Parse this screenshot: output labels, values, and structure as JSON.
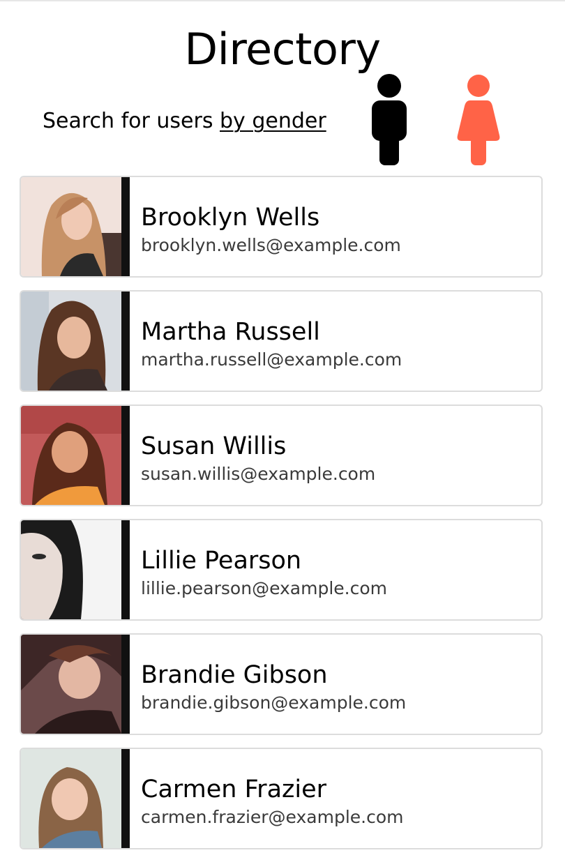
{
  "header": {
    "title": "Directory",
    "search_prefix": "Search for users ",
    "search_link": "by gender"
  },
  "gender_filter": {
    "male_icon": "male-person-icon",
    "female_icon": "female-person-icon",
    "male_color": "#000000",
    "female_color": "#ff6347"
  },
  "users": [
    {
      "name": "Brooklyn Wells",
      "email": "brooklyn.wells@example.com"
    },
    {
      "name": "Martha Russell",
      "email": "martha.russell@example.com"
    },
    {
      "name": "Susan Willis",
      "email": "susan.willis@example.com"
    },
    {
      "name": "Lillie Pearson",
      "email": "lillie.pearson@example.com"
    },
    {
      "name": "Brandie Gibson",
      "email": "brandie.gibson@example.com"
    },
    {
      "name": "Carmen Frazier",
      "email": "carmen.frazier@example.com"
    }
  ]
}
